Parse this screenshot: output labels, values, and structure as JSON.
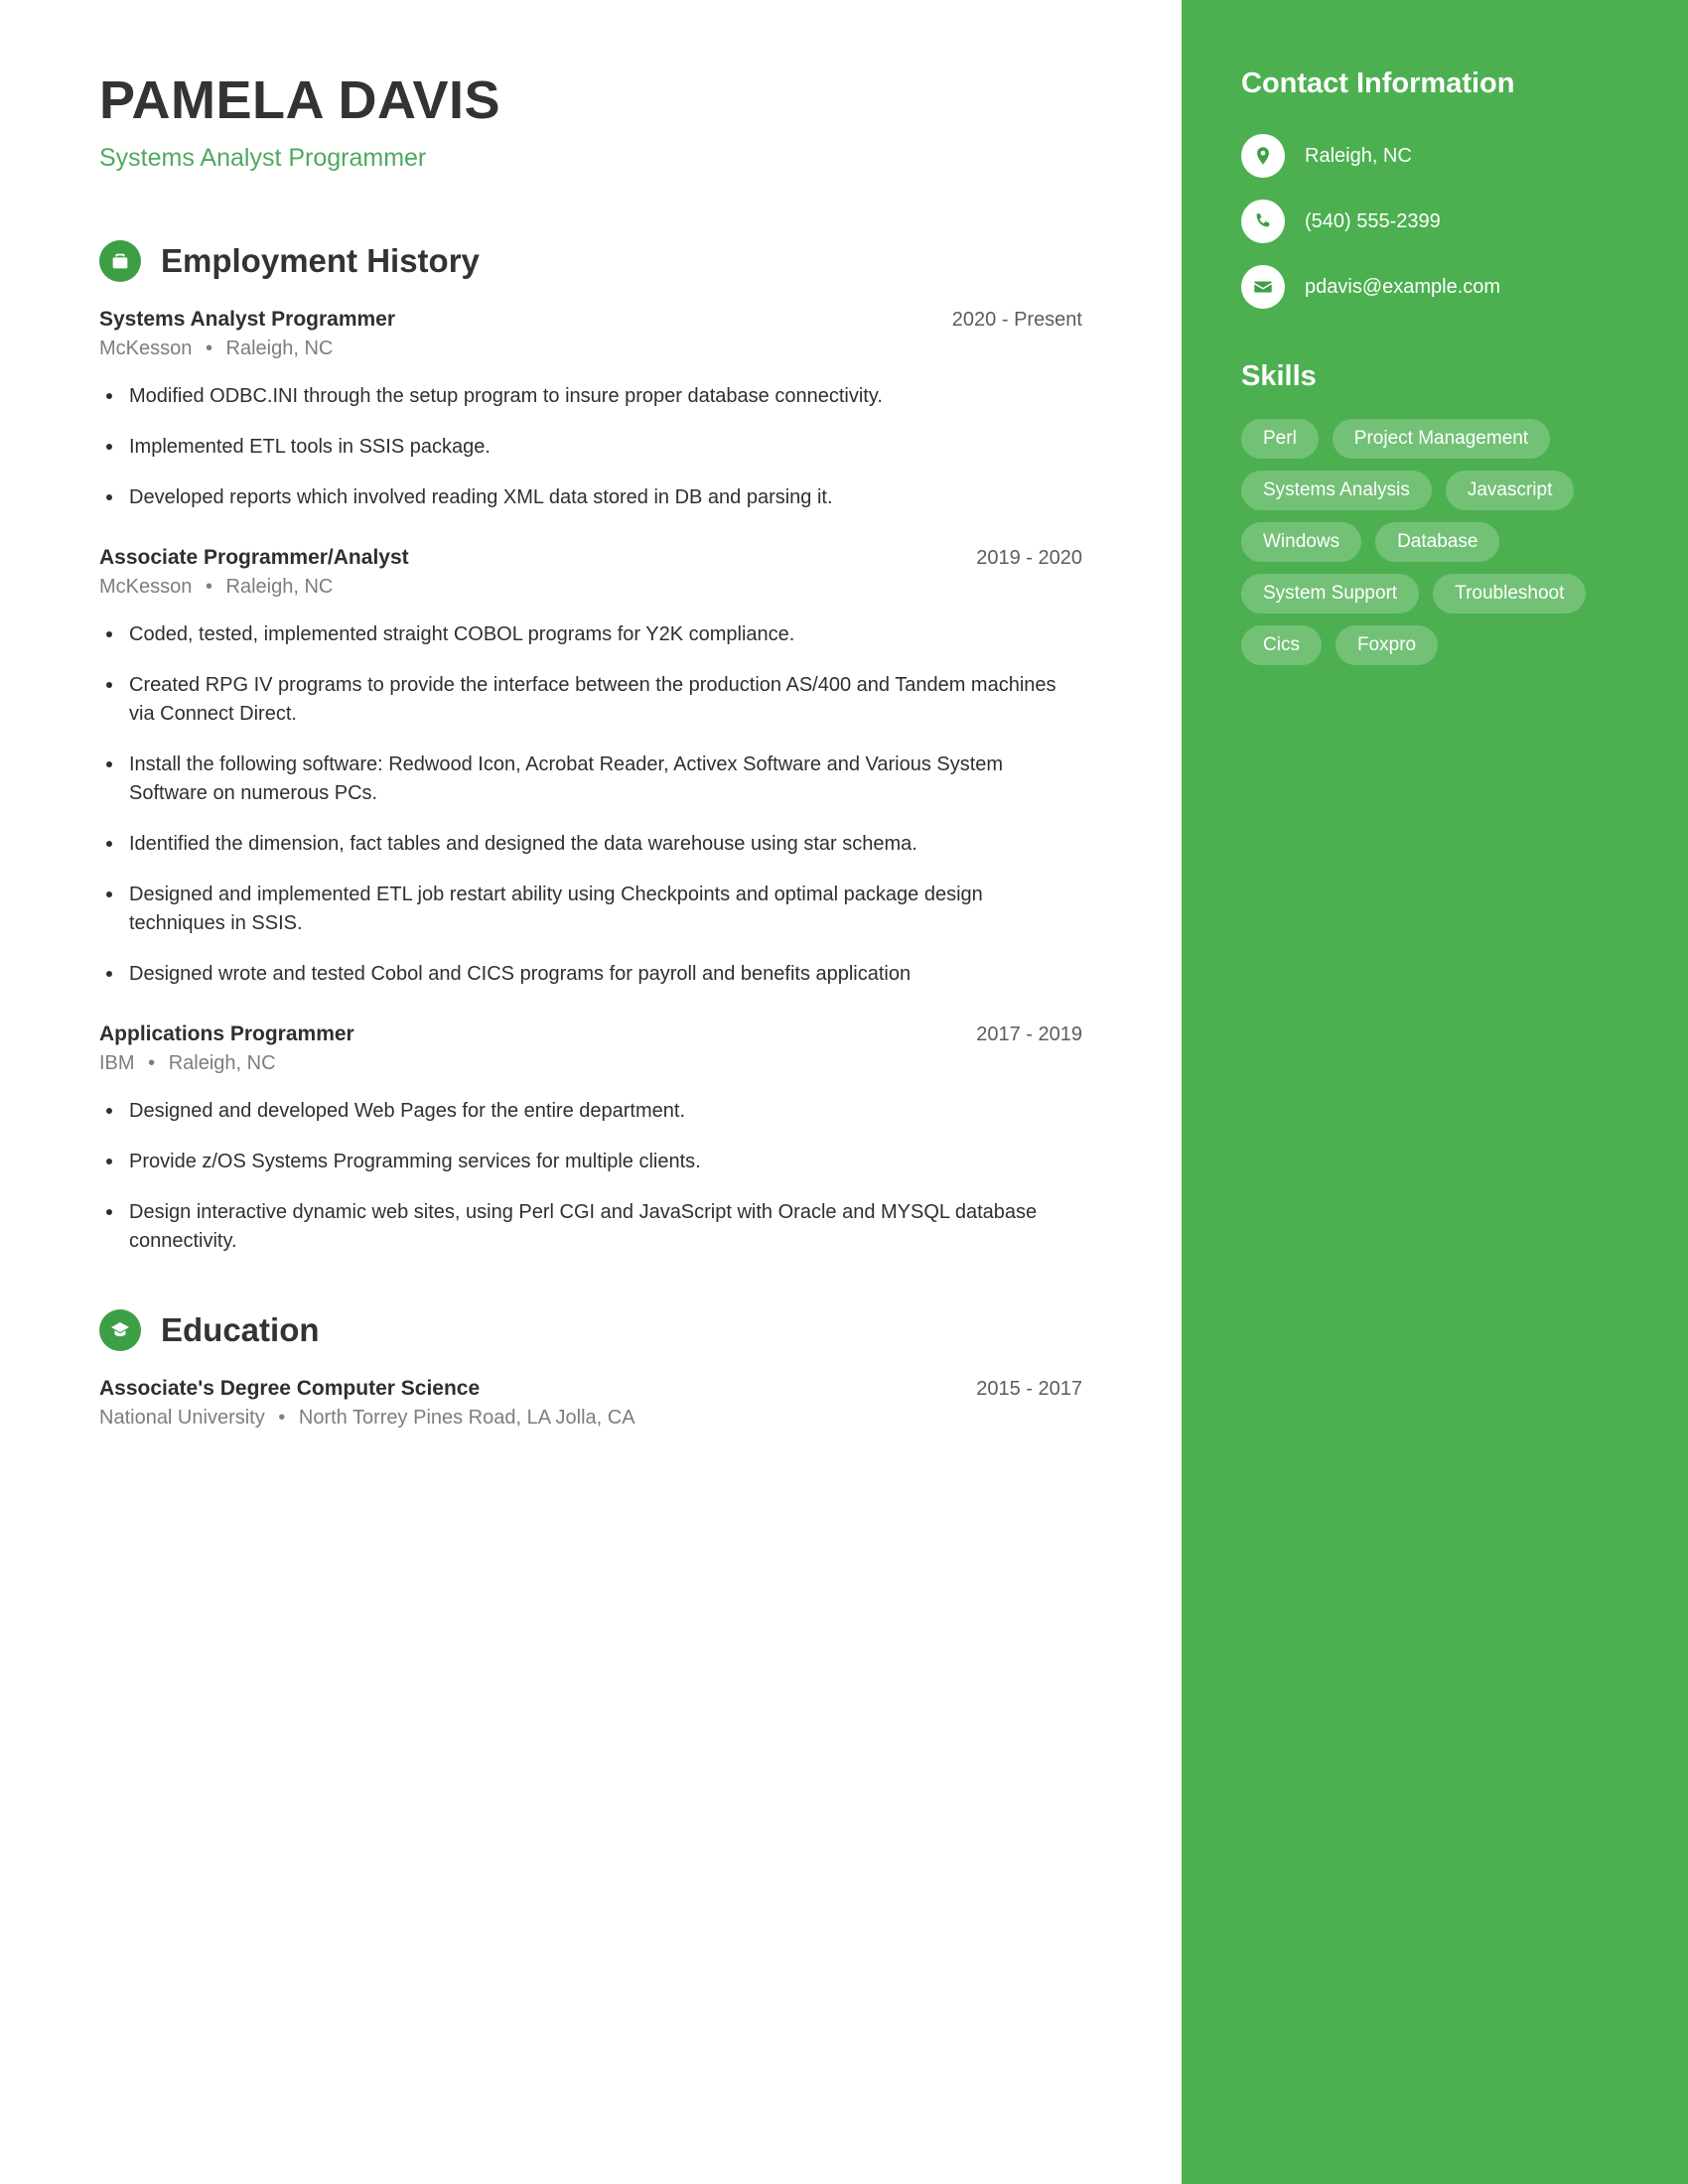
{
  "header": {
    "name": "PAMELA DAVIS",
    "subtitle": "Systems Analyst Programmer"
  },
  "employment": {
    "section_title": "Employment History",
    "icon": "briefcase-icon",
    "entries": [
      {
        "title": "Systems Analyst Programmer",
        "date": "2020 - Present",
        "company": "McKesson",
        "location": "Raleigh, NC",
        "bullets": [
          "Modified ODBC.INI through the setup program to insure proper database connectivity.",
          "Implemented ETL tools in SSIS package.",
          "Developed reports which involved reading XML data stored in DB and parsing it."
        ]
      },
      {
        "title": "Associate Programmer/Analyst",
        "date": "2019 - 2020",
        "company": "McKesson",
        "location": "Raleigh, NC",
        "bullets": [
          "Coded, tested, implemented straight COBOL programs for Y2K compliance.",
          "Created RPG IV programs to provide the interface between the production AS/400 and Tandem machines via Connect Direct.",
          "Install the following software: Redwood Icon, Acrobat Reader, Activex Software and Various System Software on numerous PCs.",
          "Identified the dimension, fact tables and designed the data warehouse using star schema.",
          "Designed and implemented ETL job restart ability using Checkpoints and optimal package design techniques in SSIS.",
          "Designed wrote and tested Cobol and CICS programs for payroll and benefits application"
        ]
      },
      {
        "title": "Applications Programmer",
        "date": "2017 - 2019",
        "company": "IBM",
        "location": "Raleigh, NC",
        "bullets": [
          "Designed and developed Web Pages for the entire department.",
          "Provide z/OS Systems Programming services for multiple clients.",
          "Design interactive dynamic web sites, using Perl CGI and JavaScript with Oracle and MYSQL database connectivity."
        ]
      }
    ]
  },
  "education": {
    "section_title": "Education",
    "icon": "graduation-cap-icon",
    "entries": [
      {
        "title": "Associate's Degree Computer Science",
        "date": "2015 - 2017",
        "school": "National University",
        "location": "North Torrey Pines Road, LA Jolla, CA"
      }
    ]
  },
  "sidebar": {
    "contact_title": "Contact Information",
    "contacts": [
      {
        "icon": "location-pin-icon",
        "text": "Raleigh, NC"
      },
      {
        "icon": "phone-icon",
        "text": "(540) 555-2399"
      },
      {
        "icon": "envelope-icon",
        "text": "pdavis@example.com"
      }
    ],
    "skills_title": "Skills",
    "skills": [
      "Perl",
      "Project Management",
      "Systems Analysis",
      "Javascript",
      "Windows",
      "Database",
      "System Support",
      "Troubleshoot",
      "Cics",
      "Foxpro"
    ]
  },
  "colors": {
    "sidebar_green": "#4cb050",
    "accent_green": "#4fa95f",
    "icon_green": "#3d9f45",
    "heading_dark": "#333333",
    "body_text": "#2f2f2f",
    "muted_text": "#7d7d7d"
  },
  "separator": "•"
}
